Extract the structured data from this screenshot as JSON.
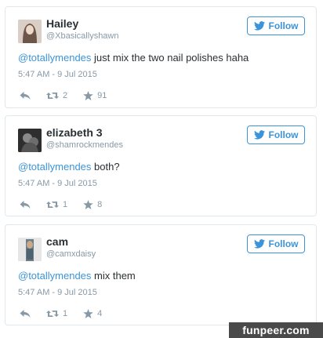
{
  "follow_label": "Follow",
  "accent_color": "#3b94d9",
  "tweets": [
    {
      "name": "Hailey",
      "handle": "@Xbasicallyshawn",
      "mention": "@totallymendes",
      "text": " just mix the two nail polishes haha",
      "time": "5:47 AM - 9 Jul 2015",
      "retweets": "2",
      "favorites": "91"
    },
    {
      "name": "elizabeth 3",
      "handle": "@shamrockmendes",
      "mention": "@totallymendes",
      "text": " both?",
      "time": "5:47 AM - 9 Jul 2015",
      "retweets": "1",
      "favorites": "8"
    },
    {
      "name": "cam",
      "handle": "@camxdaisy",
      "mention": "@totallymendes",
      "text": " mix them",
      "time": "5:47 AM - 9 Jul 2015",
      "retweets": "1",
      "favorites": "4"
    }
  ],
  "watermark": "funpeer.com",
  "icons": {
    "follow": "twitter-bird-icon",
    "reply": "reply-icon",
    "retweet": "retweet-icon",
    "favorite": "star-icon"
  }
}
